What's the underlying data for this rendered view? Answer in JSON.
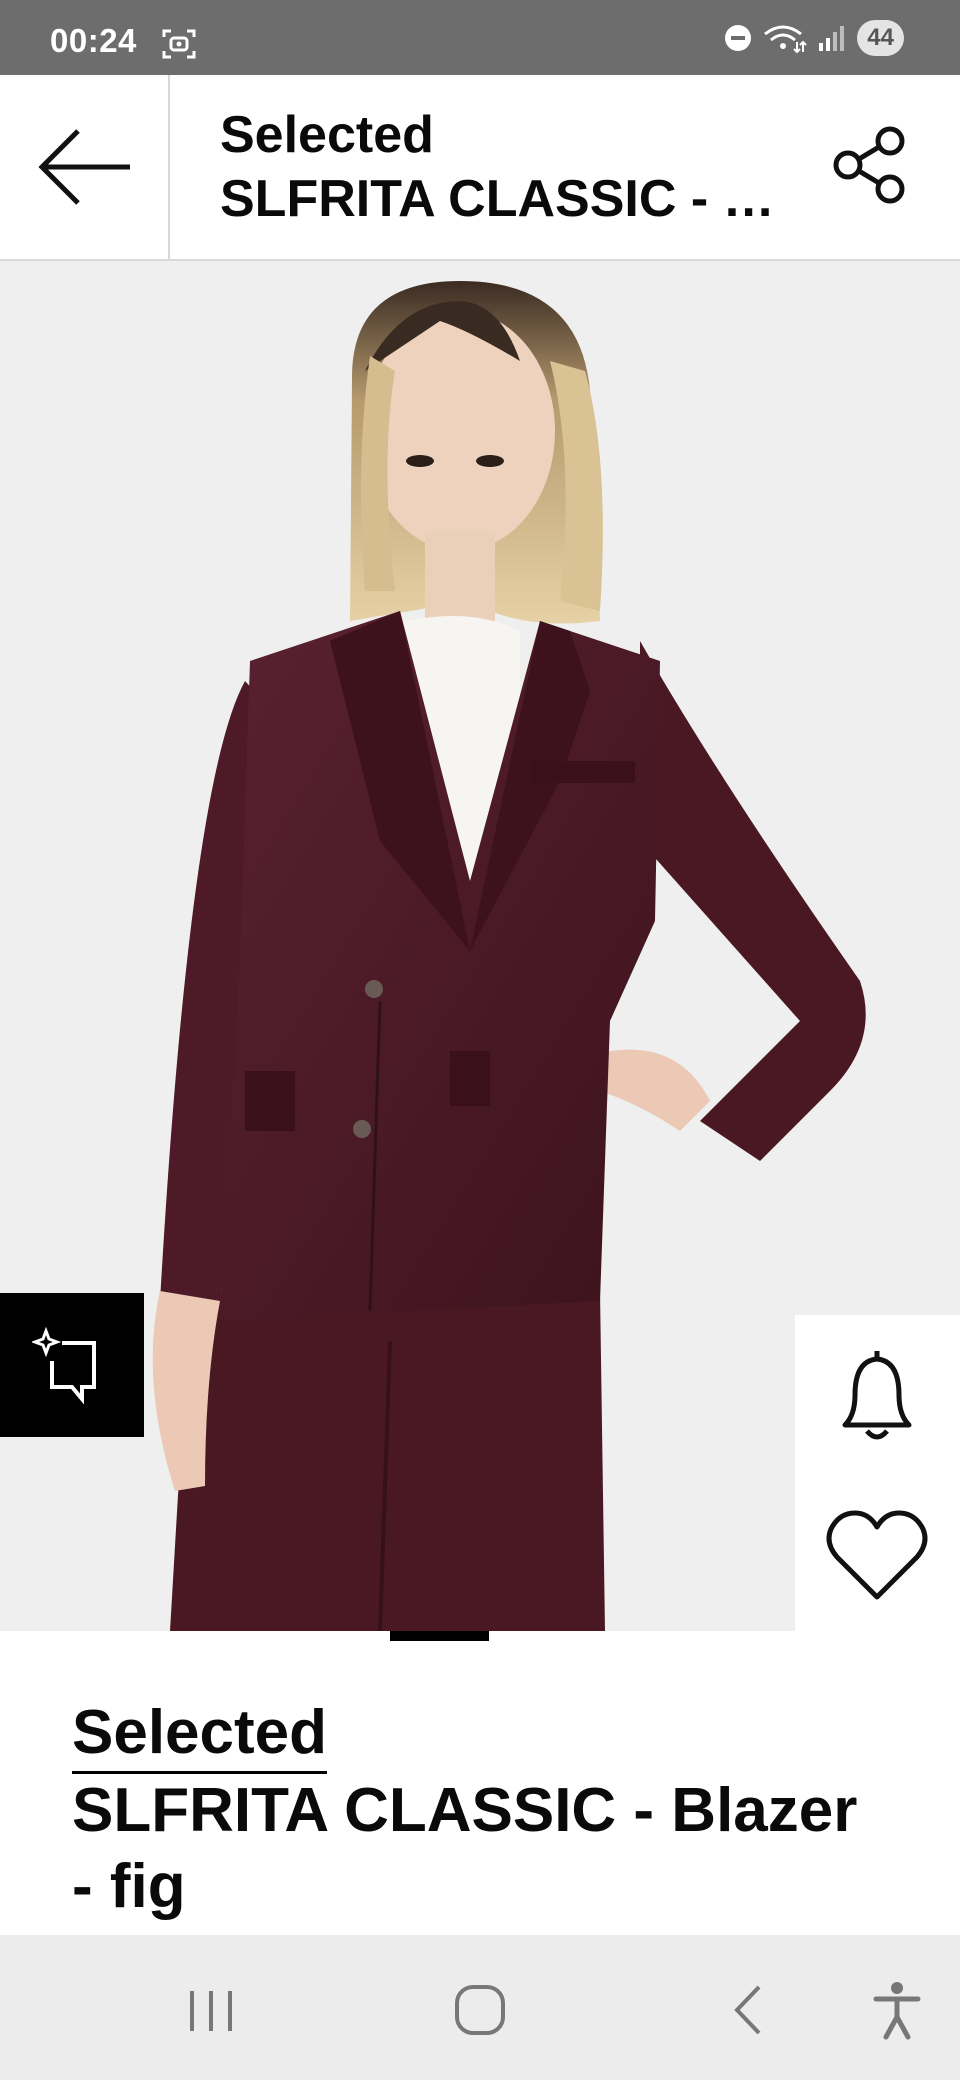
{
  "status_bar": {
    "time": "00:24",
    "battery": "44",
    "icons": [
      "screen-capture-icon",
      "do-not-disturb-icon",
      "wifi-icon",
      "signal-icon"
    ]
  },
  "header": {
    "brand": "Selected",
    "title": "SLFRITA CLASSIC - Blazer - fig",
    "back_icon": "arrow-left-icon",
    "share_icon": "share-icon"
  },
  "product": {
    "image": "Model wearing fig-coloured blazer and trousers with white top",
    "brand": "Selected",
    "name": "SLFRITA CLASSIC - Blazer - fig",
    "carousel": {
      "current_page": 1,
      "total_pages": 3
    },
    "icons": [
      "virtual-try-on-icon",
      "bell-icon",
      "heart-icon"
    ]
  },
  "colors": {
    "status_bar": "#6d6d6d",
    "blazer": "#4a1823",
    "background": "#efefef",
    "text": "#0a0a0a"
  },
  "nav_bar": {
    "icons": [
      "recent-apps-icon",
      "home-icon",
      "back-icon",
      "accessibility-icon"
    ]
  }
}
